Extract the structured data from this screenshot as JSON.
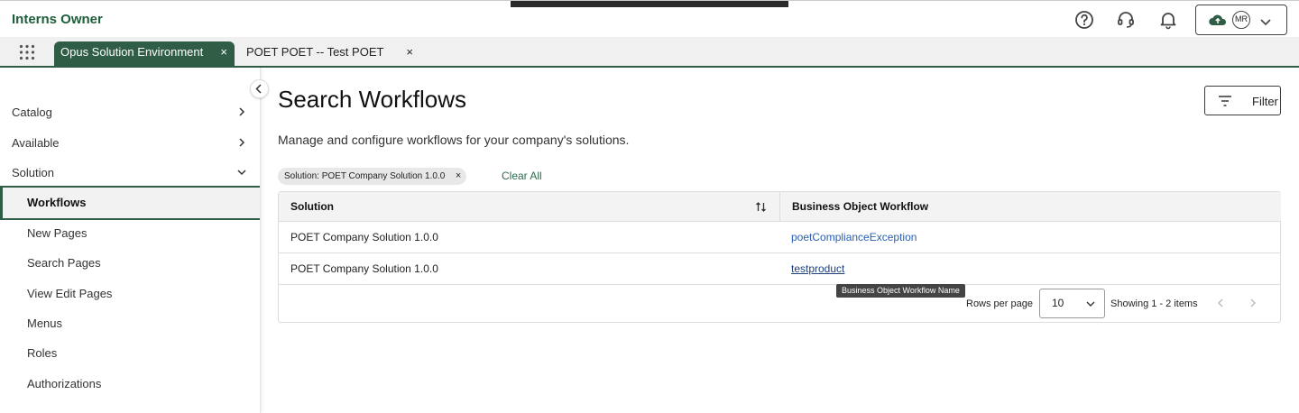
{
  "app": {
    "title": "Interns Owner"
  },
  "user": {
    "initials": "MR"
  },
  "tabs": [
    {
      "label": "Opus Solution Environment",
      "close": "×",
      "active": true
    },
    {
      "label": "POET POET -- Test POET",
      "close": "×",
      "active": false
    }
  ],
  "sidebar": {
    "items": [
      {
        "label": "Catalog"
      },
      {
        "label": "Available"
      },
      {
        "label": "Solution"
      },
      {
        "label": "Workflows"
      },
      {
        "label": "New Pages"
      },
      {
        "label": "Search Pages"
      },
      {
        "label": "View Edit Pages"
      },
      {
        "label": "Menus"
      },
      {
        "label": "Roles"
      },
      {
        "label": "Authorizations"
      }
    ]
  },
  "main": {
    "title": "Search Workflows",
    "subtitle": "Manage and configure workflows for your company's solutions.",
    "filter_label": "Filter",
    "chip_label": "Solution: POET Company Solution 1.0.0",
    "chip_close": "×",
    "clear_all": "Clear All"
  },
  "table": {
    "headers": [
      "Solution",
      "Business Object Workflow"
    ],
    "rows": [
      [
        "POET Company Solution 1.0.0",
        "poetComplianceException"
      ],
      [
        "POET Company Solution 1.0.0",
        "testproduct"
      ]
    ],
    "tooltip": "Business Object Workflow Name"
  },
  "pagination": {
    "rows_per_page_label": "Rows per page",
    "rows_per_page_value": "10",
    "showing": "Showing 1 - 2 items"
  },
  "colors": {
    "brand": "#2f5d45",
    "link": "#2a5fb3"
  },
  "icons": [
    "help-icon",
    "support-headset-icon",
    "bell-icon",
    "cloud-icon",
    "chevron-down-icon",
    "apps-grid-icon",
    "close-icon",
    "chevron-left-icon",
    "chevron-right-icon",
    "filter-icon",
    "sort-icon"
  ]
}
